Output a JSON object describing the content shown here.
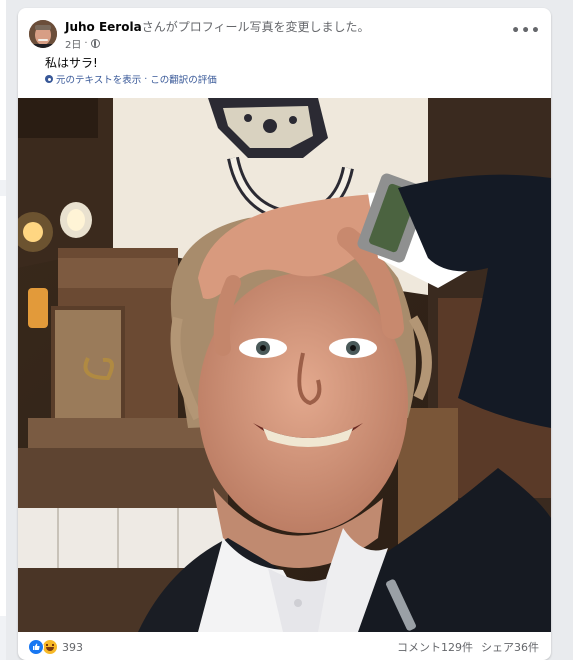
{
  "post": {
    "author": "Juho Eerola",
    "action_text": "さんがプロフィール写真を変更しました。",
    "time": "2日",
    "privacy_icon": "globe-icon",
    "more_icon": "more-horizontal-icon",
    "text": "私はサラ!",
    "translation": {
      "show_original": "元のテキストを表示",
      "separator": " · ",
      "rate_translation": "この翻訳の評価"
    }
  },
  "footer": {
    "reactions_count": "393",
    "reaction_icons": [
      "like-icon",
      "haha-icon"
    ],
    "comments": "コメント129件",
    "shares": "シェア36件"
  },
  "colors": {
    "link": "#385898",
    "meta": "#65676b",
    "like": "#1877f2",
    "haha": "#f7b928"
  }
}
